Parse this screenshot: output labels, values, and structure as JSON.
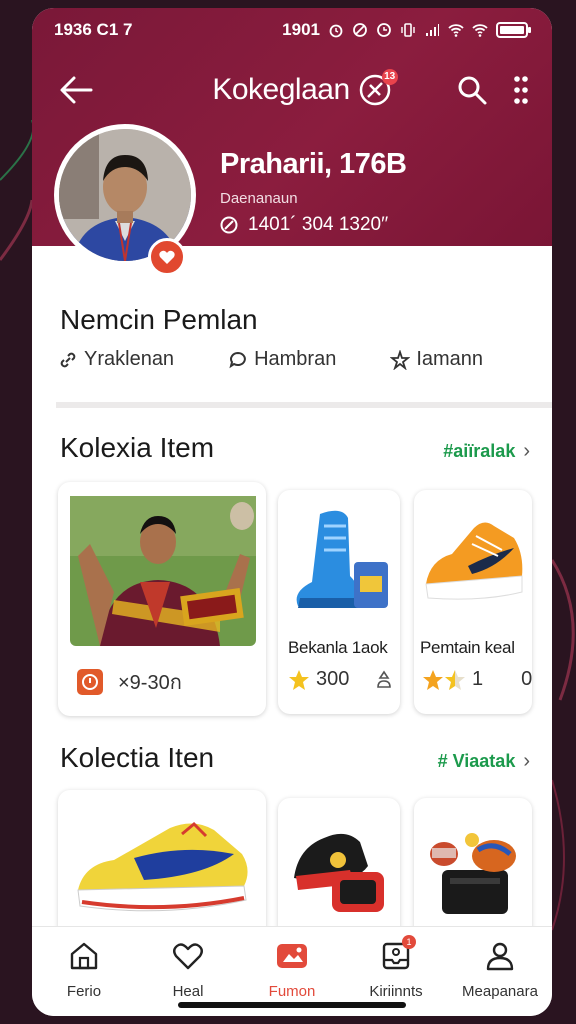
{
  "status_bar": {
    "left_time": "1​936 C1 7",
    "right_time": "1901",
    "icons": [
      "alarm-icon",
      "dnd-icon",
      "clock-icon",
      "vibrate-icon",
      "signal-icon",
      "wifi-icon",
      "wifi-icon",
      "battery-icon"
    ]
  },
  "header": {
    "title": "Kokeglaan",
    "title_badge": "13",
    "accent_color": "#8b1d3e"
  },
  "profile": {
    "name": "Praharii, 176B",
    "subtitle": "Daenanaun",
    "stats": "1401´  304 1320′′",
    "badge_color": "#e1482f"
  },
  "section_actions": {
    "title": "Nemcin Pemlan",
    "items": [
      {
        "label": "Yraklenan",
        "icon": "link-icon"
      },
      {
        "label": "Hambran",
        "icon": "chat-icon"
      },
      {
        "label": "Iamann",
        "icon": "share-icon"
      }
    ]
  },
  "collection_1": {
    "title": "Kolexia Item",
    "see_all": "#aiïralak",
    "featured": {
      "price": "×9-30ก"
    },
    "items": [
      {
        "label": "Bekanla 1aok",
        "rating": "300"
      },
      {
        "label": "Pemtain keal",
        "rating": "1",
        "count": "0"
      }
    ]
  },
  "collection_2": {
    "title": "Kolectia Iten",
    "see_all": "# Viaatak"
  },
  "bottom_nav": {
    "items": [
      {
        "label": "Ferio",
        "icon": "home-icon"
      },
      {
        "label": "Heal",
        "icon": "heart-icon"
      },
      {
        "label": "Fumon",
        "icon": "photo-icon",
        "active": true
      },
      {
        "label": "Kiriinnts",
        "icon": "inbox-icon",
        "badge": "1"
      },
      {
        "label": "Meapanara",
        "icon": "profile-icon"
      }
    ],
    "active_color": "#e24a3b"
  }
}
